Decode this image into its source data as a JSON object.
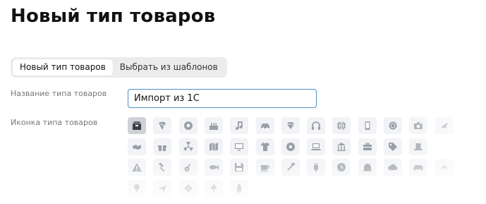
{
  "page": {
    "title": "Новый тип товаров"
  },
  "tabs": [
    {
      "label": "Новый тип товаров",
      "active": true
    },
    {
      "label": "Выбрать из шаблонов",
      "active": false
    }
  ],
  "form": {
    "name_label": "Название типа товаров",
    "name_value": "Импорт из 1С",
    "icon_label": "Иконка типа товаров"
  },
  "icons": [
    [
      "box-icon",
      "pizza-icon",
      "soccer-ball-icon",
      "birthday-cake-icon",
      "music-note-icon",
      "car-icon",
      "diamond-icon",
      "headphones-icon",
      "globe-icon",
      "smartphone-icon",
      "coin-icon",
      "camera-icon",
      "bird-icon"
    ],
    [
      "handshake-icon",
      "gift-icon",
      "radiation-icon",
      "map-icon",
      "monitor-icon",
      "tshirt-icon",
      "disc-icon",
      "laptop-icon",
      "bank-icon",
      "briefcase-icon",
      "tag-icon",
      "top-hat-icon"
    ],
    [
      "warning-icon",
      "hammer-icon",
      "guitar-icon",
      "fish-icon",
      "floppy-disk-icon",
      "coffee-cup-icon",
      "tools-icon",
      "plug-icon",
      "clock-icon",
      "dome-icon",
      "cloud-icon",
      "sofa-icon",
      "chevron-icon"
    ],
    [
      "pin-icon",
      "plane-icon",
      "flower-icon",
      "tree-icon",
      "bottle-icon"
    ]
  ],
  "selected_icon": "box-icon",
  "colors": {
    "input_border": "#4a90c8",
    "icon_glyph": "#9aa0a8",
    "selected_bg": "#cfd1d6"
  }
}
